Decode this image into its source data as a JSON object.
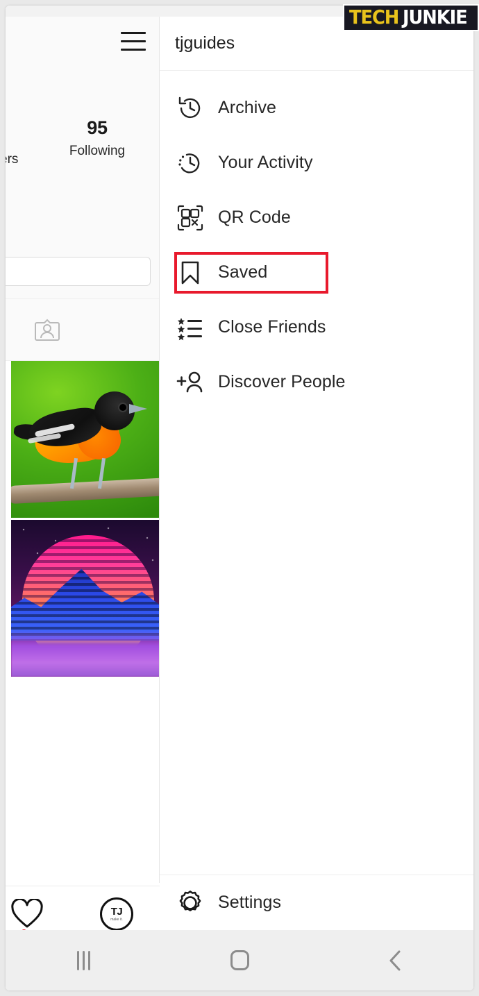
{
  "watermark": {
    "part1": "TECH",
    "part2": "JUNKIE",
    "color_part1": "#e8c21c",
    "color_part2": "#ffffff",
    "background": "#181822"
  },
  "profile": {
    "menu_toggle_icon": "hamburger-icon",
    "following_count": "95",
    "following_label": "Following",
    "followers_label_clipped": "ers",
    "edit_profile_value": "",
    "tagged_tab_icon": "tagged-photos-icon",
    "posts": [
      {
        "name": "post-bird",
        "alt": "Baltimore oriole perched on a branch"
      },
      {
        "name": "post-synthwave",
        "alt": "Retrowave sunset over mountains"
      }
    ]
  },
  "app_nav": {
    "items": [
      {
        "name": "activity-heart-icon",
        "label": "",
        "badge": true
      },
      {
        "name": "profile-avatar",
        "label": "TJ",
        "sublabel": "make it."
      }
    ]
  },
  "menu": {
    "username": "tjguides",
    "items": [
      {
        "icon": "archive-clock-icon",
        "label": "Archive",
        "highlighted": false
      },
      {
        "icon": "your-activity-clock-icon",
        "label": "Your Activity",
        "highlighted": false
      },
      {
        "icon": "qr-code-icon",
        "label": "QR Code",
        "highlighted": false
      },
      {
        "icon": "bookmark-saved-icon",
        "label": "Saved",
        "highlighted": true
      },
      {
        "icon": "close-friends-list-icon",
        "label": "Close Friends",
        "highlighted": false
      },
      {
        "icon": "discover-people-icon",
        "label": "Discover People",
        "highlighted": false
      }
    ],
    "footer": {
      "icon": "gear-icon",
      "label": "Settings"
    },
    "highlight_color": "#e8192c"
  },
  "system_nav": {
    "recents_label": "recents-icon",
    "home_label": "home-icon",
    "back_label": "back-icon"
  }
}
